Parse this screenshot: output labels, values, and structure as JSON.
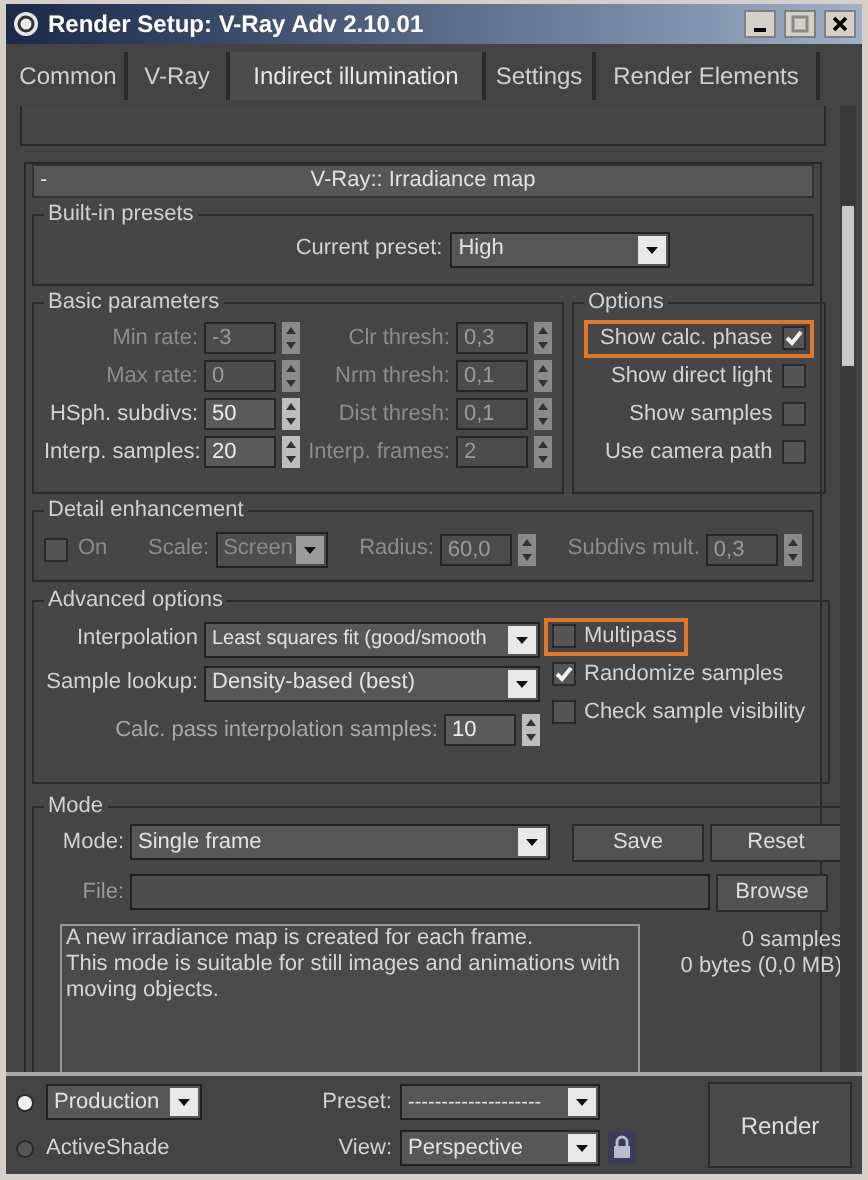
{
  "window": {
    "title": "Render Setup: V-Ray Adv 2.10.01"
  },
  "tabs": [
    {
      "label": "Common",
      "selected": false
    },
    {
      "label": "V-Ray",
      "selected": false
    },
    {
      "label": "Indirect illumination",
      "selected": true
    },
    {
      "label": "Settings",
      "selected": false
    },
    {
      "label": "Render Elements",
      "selected": false
    }
  ],
  "rollout": {
    "toggle": "-",
    "title": "V-Ray:: Irradiance map"
  },
  "built_in_presets": {
    "title": "Built-in presets",
    "label": "Current preset:",
    "value": "High"
  },
  "basic_parameters": {
    "title": "Basic parameters",
    "rows": [
      {
        "left": {
          "label": "Min rate:",
          "value": "-3",
          "disabled": true
        },
        "right": {
          "label": "Clr thresh:",
          "value": "0,3",
          "disabled": true
        }
      },
      {
        "left": {
          "label": "Max rate:",
          "value": "0",
          "disabled": true
        },
        "right": {
          "label": "Nrm thresh:",
          "value": "0,1",
          "disabled": true
        }
      },
      {
        "left": {
          "label": "HSph. subdivs:",
          "value": "50",
          "disabled": false
        },
        "right": {
          "label": "Dist thresh:",
          "value": "0,1",
          "disabled": true
        }
      },
      {
        "left": {
          "label": "Interp. samples:",
          "value": "20",
          "disabled": false
        },
        "right": {
          "label": "Interp. frames:",
          "value": "2",
          "disabled": true
        }
      }
    ]
  },
  "options": {
    "title": "Options",
    "items": [
      {
        "label": "Show calc. phase",
        "checked": true,
        "highlighted": true
      },
      {
        "label": "Show direct light",
        "checked": false,
        "highlighted": false
      },
      {
        "label": "Show samples",
        "checked": false,
        "highlighted": false
      },
      {
        "label": "Use camera path",
        "checked": false,
        "highlighted": false
      }
    ]
  },
  "detail_enhancement": {
    "title": "Detail enhancement",
    "on": {
      "label": "On",
      "checked": false
    },
    "scale": {
      "label": "Scale:",
      "value": "Screen"
    },
    "radius": {
      "label": "Radius:",
      "value": "60,0"
    },
    "subdivs_mult": {
      "label": "Subdivs mult.",
      "value": "0,3"
    }
  },
  "advanced_options": {
    "title": "Advanced options",
    "interpolation": {
      "label": "Interpolation",
      "value": "Least squares fit (good/smooth"
    },
    "sample_lookup": {
      "label": "Sample lookup:",
      "value": "Density-based (best)"
    },
    "calc_pass": {
      "label": "Calc. pass interpolation samples:",
      "value": "10"
    },
    "checkboxes": [
      {
        "label": "Multipass",
        "checked": false,
        "highlighted": true
      },
      {
        "label": "Randomize samples",
        "checked": true,
        "highlighted": false
      },
      {
        "label": "Check sample visibility",
        "checked": false,
        "highlighted": false
      }
    ]
  },
  "mode": {
    "title": "Mode",
    "mode_label": "Mode:",
    "mode_value": "Single frame",
    "save": "Save",
    "reset": "Reset",
    "file_label": "File:",
    "browse": "Browse",
    "description": "A new irradiance map is created for each frame.\nThis mode is suitable for still images and animations with\nmoving objects.",
    "samples": "0 samples",
    "size": "0 bytes (0,0 MB)"
  },
  "bottom": {
    "targets": [
      {
        "kind": "dropdown",
        "label": "Production",
        "selected": true
      },
      {
        "kind": "label",
        "label": "ActiveShade",
        "selected": false
      }
    ],
    "preset": {
      "label": "Preset:",
      "value": "--------------------"
    },
    "view": {
      "label": "View:",
      "value": "Perspective"
    },
    "render": "Render"
  }
}
